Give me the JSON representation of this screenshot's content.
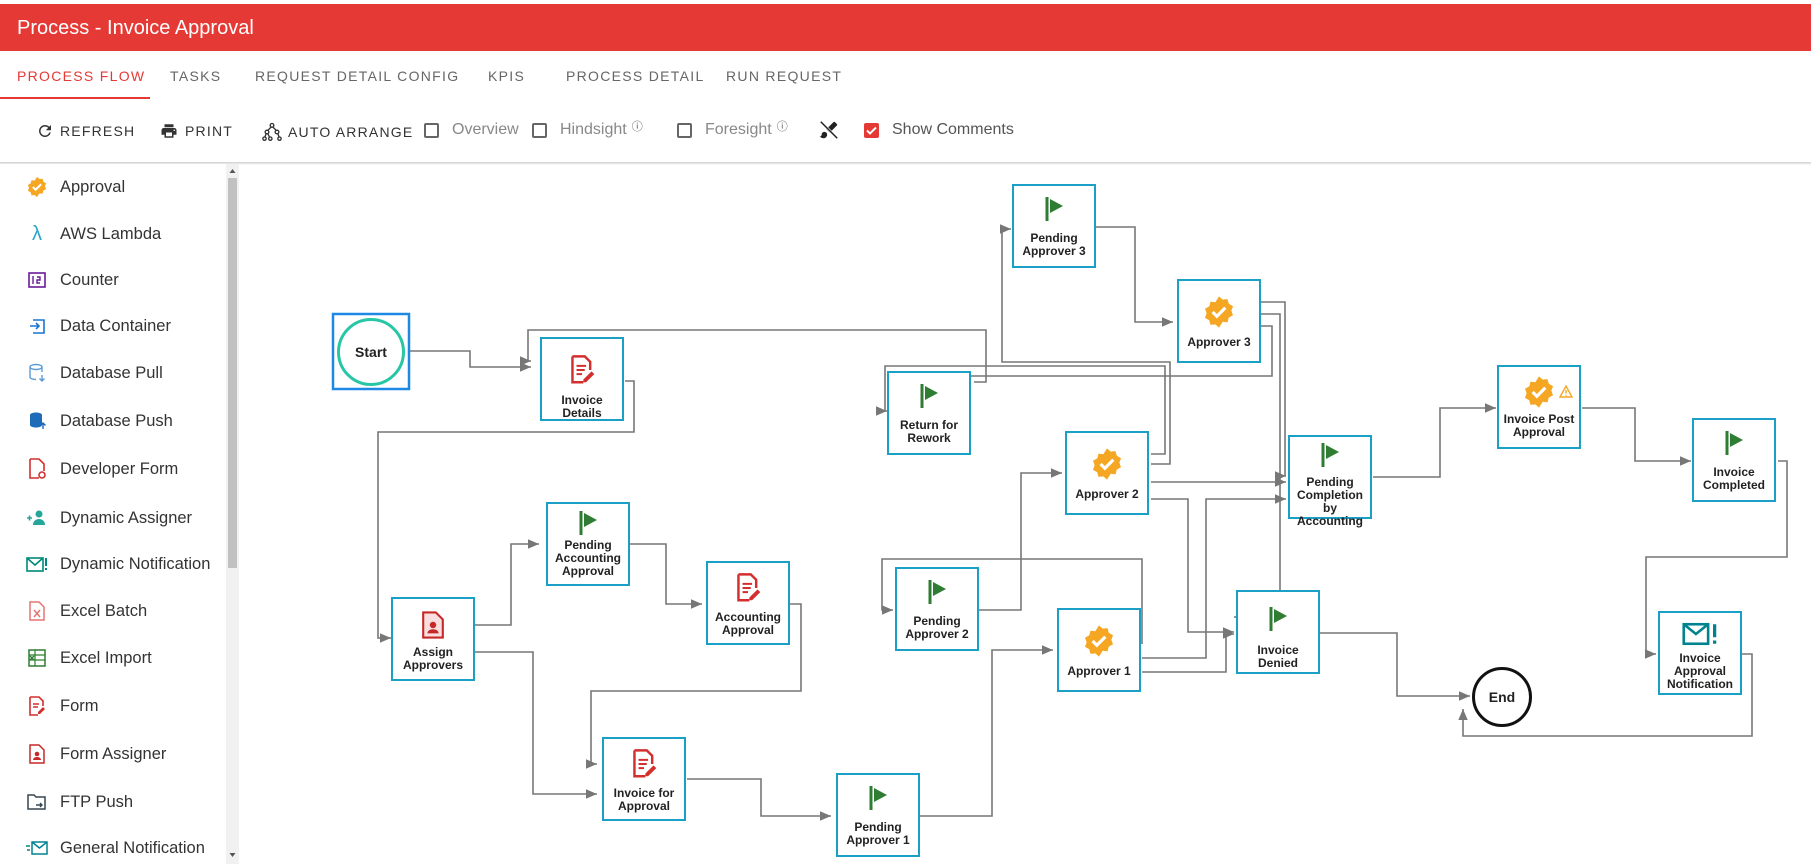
{
  "title": "Process - Invoice Approval",
  "tabs": [
    "PROCESS FLOW",
    "TASKS",
    "REQUEST DETAIL CONFIG",
    "KPIS",
    "PROCESS DETAIL",
    "RUN REQUEST"
  ],
  "toolbar": {
    "refresh": "REFRESH",
    "print": "PRINT",
    "auto_arrange": "AUTO ARRANGE",
    "overview": "Overview",
    "hindsight": "Hindsight",
    "foresight": "Foresight",
    "show_comments": "Show Comments",
    "show_comments_checked": true
  },
  "palette": [
    "Approval",
    "AWS Lambda",
    "Counter",
    "Data Container",
    "Database Pull",
    "Database Push",
    "Developer Form",
    "Dynamic Assigner",
    "Dynamic Notification",
    "Excel Batch",
    "Excel Import",
    "Form",
    "Form Assigner",
    "FTP Push",
    "General Notification"
  ],
  "nodes": {
    "start": "Start",
    "end": "End",
    "invoice_details": "Invoice Details",
    "assign_approvers": "Assign Approvers",
    "pending_accounting_approval": "Pending Accounting Approval",
    "accounting_approval": "Accounting Approval",
    "invoice_for_approval": "Invoice for Approval",
    "pending_approver_1": "Pending Approver 1",
    "return_for_rework": "Return for Rework",
    "pending_approver_2": "Pending Approver 2",
    "approver_1": "Approver 1",
    "approver_2": "Approver 2",
    "pending_approver_3": "Pending Approver 3",
    "approver_3": "Approver 3",
    "pending_completion": "Pending Completion by Accounting",
    "invoice_denied": "Invoice Denied",
    "invoice_post_approval": "Invoice Post Approval",
    "invoice_completed": "Invoice Completed",
    "invoice_approval_notification": "Invoice Approval Notification"
  },
  "colors": {
    "accent": "#e53935",
    "node_border": "#1aa0c7",
    "flag": "#2e7d32",
    "badge": "#f5a623",
    "form_red": "#d32f2f"
  }
}
